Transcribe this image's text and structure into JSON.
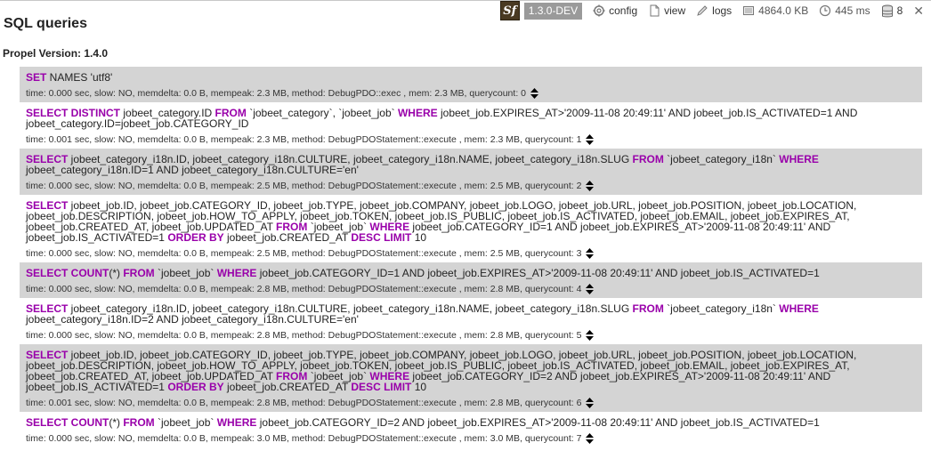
{
  "toolbar": {
    "logo": "Sf",
    "version": "1.3.0-DEV",
    "config_label": "config",
    "view_label": "view",
    "logs_label": "logs",
    "memory": "4864.0 KB",
    "time": "445 ms",
    "queries_count": "8",
    "close": "✕"
  },
  "panel": {
    "title": "SQL queries",
    "propel_version": "Propel Version: 1.4.0"
  },
  "queries": [
    {
      "sql": [
        [
          "kw",
          "SET"
        ],
        [
          "t",
          " NAMES 'utf8'"
        ]
      ],
      "info": "time: 0.000 sec, slow: NO, memdelta: 0.0 B, mempeak: 2.3 MB, method: DebugPDO::exec , mem: 2.3 MB, querycount: 0"
    },
    {
      "sql": [
        [
          "kw",
          "SELECT DISTINCT"
        ],
        [
          "t",
          " jobeet_category.ID "
        ],
        [
          "kw",
          "FROM"
        ],
        [
          "t",
          " `jobeet_category`, `jobeet_job` "
        ],
        [
          "kw",
          "WHERE"
        ],
        [
          "t",
          " jobeet_job.EXPIRES_AT>'2009-11-08 20:49:11' AND jobeet_job.IS_ACTIVATED=1 AND jobeet_category.ID=jobeet_job.CATEGORY_ID"
        ]
      ],
      "info": "time: 0.001 sec, slow: NO, memdelta: 0.0 B, mempeak: 2.3 MB, method: DebugPDOStatement::execute , mem: 2.3 MB, querycount: 1"
    },
    {
      "sql": [
        [
          "kw",
          "SELECT"
        ],
        [
          "t",
          " jobeet_category_i18n.ID, jobeet_category_i18n.CULTURE, jobeet_category_i18n.NAME, jobeet_category_i18n.SLUG "
        ],
        [
          "kw",
          "FROM"
        ],
        [
          "t",
          " `jobeet_category_i18n` "
        ],
        [
          "kw",
          "WHERE"
        ],
        [
          "t",
          " jobeet_category_i18n.ID=1 AND jobeet_category_i18n.CULTURE='en'"
        ]
      ],
      "info": "time: 0.000 sec, slow: NO, memdelta: 0.0 B, mempeak: 2.5 MB, method: DebugPDOStatement::execute , mem: 2.5 MB, querycount: 2"
    },
    {
      "sql": [
        [
          "kw",
          "SELECT"
        ],
        [
          "t",
          " jobeet_job.ID, jobeet_job.CATEGORY_ID, jobeet_job.TYPE, jobeet_job.COMPANY, jobeet_job.LOGO, jobeet_job.URL, jobeet_job.POSITION, jobeet_job.LOCATION, jobeet_job.DESCRIPTION, jobeet_job.HOW_TO_APPLY, jobeet_job.TOKEN, jobeet_job.IS_PUBLIC, jobeet_job.IS_ACTIVATED, jobeet_job.EMAIL, jobeet_job.EXPIRES_AT, jobeet_job.CREATED_AT, jobeet_job.UPDATED_AT "
        ],
        [
          "kw",
          "FROM"
        ],
        [
          "t",
          " `jobeet_job` "
        ],
        [
          "kw",
          "WHERE"
        ],
        [
          "t",
          " jobeet_job.CATEGORY_ID=1 AND jobeet_job.EXPIRES_AT>'2009-11-08 20:49:11' AND jobeet_job.IS_ACTIVATED=1 "
        ],
        [
          "kw",
          "ORDER BY"
        ],
        [
          "t",
          " jobeet_job.CREATED_AT "
        ],
        [
          "kw",
          "DESC LIMIT"
        ],
        [
          "t",
          " 10"
        ]
      ],
      "info": "time: 0.000 sec, slow: NO, memdelta: 0.0 B, mempeak: 2.5 MB, method: DebugPDOStatement::execute , mem: 2.5 MB, querycount: 3"
    },
    {
      "sql": [
        [
          "kw",
          "SELECT COUNT"
        ],
        [
          "t",
          "(*) "
        ],
        [
          "kw",
          "FROM"
        ],
        [
          "t",
          " `jobeet_job` "
        ],
        [
          "kw",
          "WHERE"
        ],
        [
          "t",
          " jobeet_job.CATEGORY_ID=1 AND jobeet_job.EXPIRES_AT>'2009-11-08 20:49:11' AND jobeet_job.IS_ACTIVATED=1"
        ]
      ],
      "info": "time: 0.000 sec, slow: NO, memdelta: 0.0 B, mempeak: 2.8 MB, method: DebugPDOStatement::execute , mem: 2.8 MB, querycount: 4"
    },
    {
      "sql": [
        [
          "kw",
          "SELECT"
        ],
        [
          "t",
          " jobeet_category_i18n.ID, jobeet_category_i18n.CULTURE, jobeet_category_i18n.NAME, jobeet_category_i18n.SLUG "
        ],
        [
          "kw",
          "FROM"
        ],
        [
          "t",
          " `jobeet_category_i18n` "
        ],
        [
          "kw",
          "WHERE"
        ],
        [
          "t",
          " jobeet_category_i18n.ID=2 AND jobeet_category_i18n.CULTURE='en'"
        ]
      ],
      "info": "time: 0.000 sec, slow: NO, memdelta: 0.0 B, mempeak: 2.8 MB, method: DebugPDOStatement::execute , mem: 2.8 MB, querycount: 5"
    },
    {
      "sql": [
        [
          "kw",
          "SELECT"
        ],
        [
          "t",
          " jobeet_job.ID, jobeet_job.CATEGORY_ID, jobeet_job.TYPE, jobeet_job.COMPANY, jobeet_job.LOGO, jobeet_job.URL, jobeet_job.POSITION, jobeet_job.LOCATION, jobeet_job.DESCRIPTION, jobeet_job.HOW_TO_APPLY, jobeet_job.TOKEN, jobeet_job.IS_PUBLIC, jobeet_job.IS_ACTIVATED, jobeet_job.EMAIL, jobeet_job.EXPIRES_AT, jobeet_job.CREATED_AT, jobeet_job.UPDATED_AT "
        ],
        [
          "kw",
          "FROM"
        ],
        [
          "t",
          " `jobeet_job` "
        ],
        [
          "kw",
          "WHERE"
        ],
        [
          "t",
          " jobeet_job.CATEGORY_ID=2 AND jobeet_job.EXPIRES_AT>'2009-11-08 20:49:11' AND jobeet_job.IS_ACTIVATED=1 "
        ],
        [
          "kw",
          "ORDER BY"
        ],
        [
          "t",
          " jobeet_job.CREATED_AT "
        ],
        [
          "kw",
          "DESC LIMIT"
        ],
        [
          "t",
          " 10"
        ]
      ],
      "info": "time: 0.001 sec, slow: NO, memdelta: 0.0 B, mempeak: 2.8 MB, method: DebugPDOStatement::execute , mem: 2.8 MB, querycount: 6"
    },
    {
      "sql": [
        [
          "kw",
          "SELECT COUNT"
        ],
        [
          "t",
          "(*) "
        ],
        [
          "kw",
          "FROM"
        ],
        [
          "t",
          " `jobeet_job` "
        ],
        [
          "kw",
          "WHERE"
        ],
        [
          "t",
          " jobeet_job.CATEGORY_ID=2 AND jobeet_job.EXPIRES_AT>'2009-11-08 20:49:11' AND jobeet_job.IS_ACTIVATED=1"
        ]
      ],
      "info": "time: 0.000 sec, slow: NO, memdelta: 0.0 B, mempeak: 3.0 MB, method: DebugPDOStatement::execute , mem: 3.0 MB, querycount: 7"
    }
  ]
}
